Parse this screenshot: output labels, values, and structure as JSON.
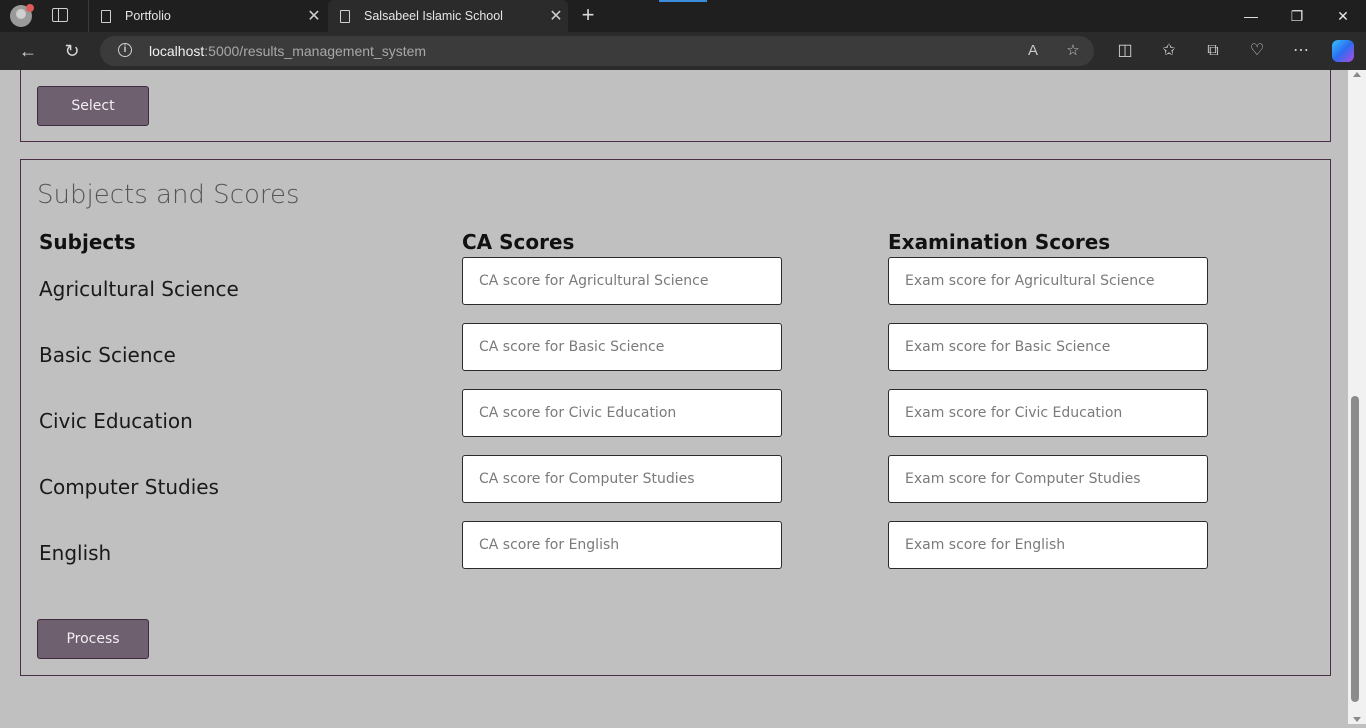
{
  "browser": {
    "tabs": [
      {
        "title": "Portfolio"
      },
      {
        "title": "Salsabeel Islamic School"
      }
    ],
    "url_host": "localhost",
    "url_rest": ":5000/results_management_system"
  },
  "top_panel": {
    "select_label": "Select"
  },
  "scores_panel": {
    "title": "Subjects and Scores",
    "headers": {
      "subjects": "Subjects",
      "ca": "CA Scores",
      "exam": "Examination Scores"
    },
    "rows": [
      {
        "subject": "Agricultural Science",
        "ca_placeholder": "CA score for Agricultural Science",
        "exam_placeholder": "Exam score for Agricultural Science"
      },
      {
        "subject": "Basic Science",
        "ca_placeholder": "CA score for Basic Science",
        "exam_placeholder": "Exam score for Basic Science"
      },
      {
        "subject": "Civic Education",
        "ca_placeholder": "CA score for Civic Education",
        "exam_placeholder": "Exam score for Civic Education"
      },
      {
        "subject": "Computer Studies",
        "ca_placeholder": "CA score for Computer Studies",
        "exam_placeholder": "Exam score for Computer Studies"
      },
      {
        "subject": "English",
        "ca_placeholder": "CA score for English",
        "exam_placeholder": "Exam score for English"
      }
    ],
    "process_label": "Process"
  },
  "colors": {
    "page_bg": "#c0c0c0",
    "button_bg": "#6e606f",
    "panel_border": "#4a2e48"
  }
}
